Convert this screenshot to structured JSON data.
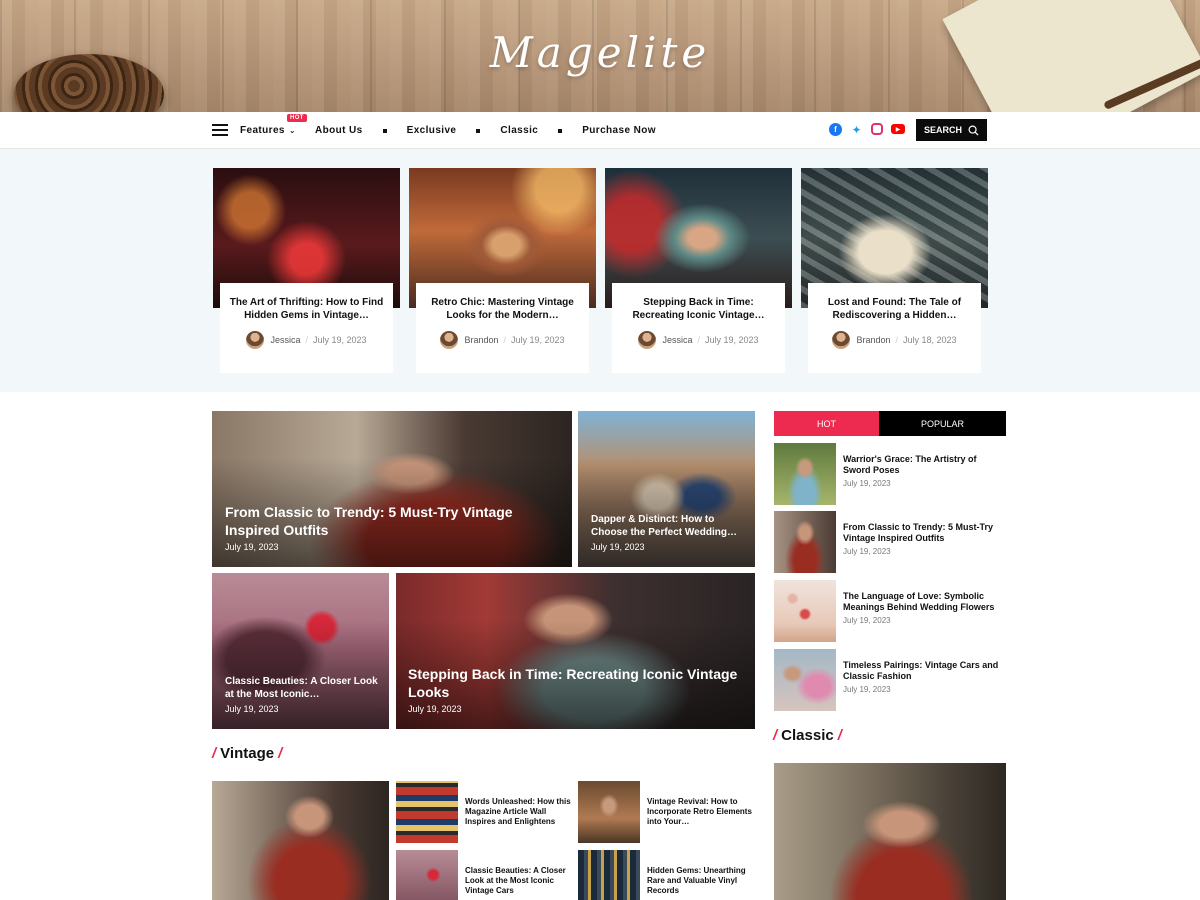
{
  "header": {
    "logo": "Magelite"
  },
  "nav": {
    "items": [
      {
        "label": "Features",
        "badge": "HOT"
      },
      {
        "label": "About Us"
      },
      {
        "label": "Exclusive"
      },
      {
        "label": "Classic"
      },
      {
        "label": "Purchase Now"
      }
    ],
    "search_label": "SEARCH",
    "colors": {
      "facebook": "#1877f2",
      "twitter": "#1da1f2",
      "instagram": "#e1306c",
      "youtube": "#ff0000"
    }
  },
  "featured": [
    {
      "title": "The Art of Thrifting: How to Find Hidden Gems in Vintage…",
      "author": "Jessica",
      "date": "July 19, 2023"
    },
    {
      "title": "Retro Chic: Mastering Vintage Looks for the Modern…",
      "author": "Brandon",
      "date": "July 19, 2023"
    },
    {
      "title": "Stepping Back in Time: Recreating Iconic Vintage…",
      "author": "Jessica",
      "date": "July 19, 2023"
    },
    {
      "title": "Lost and Found: The Tale of Rediscovering a Hidden…",
      "author": "Brandon",
      "date": "July 18, 2023"
    }
  ],
  "mosaic": [
    {
      "title": "From Classic to Trendy: 5 Must-Try Vintage Inspired Outfits",
      "date": "July 19, 2023"
    },
    {
      "title": "Dapper & Distinct: How to Choose the Perfect Wedding…",
      "date": "July 19, 2023"
    },
    {
      "title": "Classic Beauties: A Closer Look at the Most Iconic…",
      "date": "July 19, 2023"
    },
    {
      "title": "Stepping Back in Time: Recreating Iconic Vintage Looks",
      "date": "July 19, 2023"
    }
  ],
  "sidebar": {
    "tabs": {
      "hot": "HOT",
      "popular": "POPULAR"
    },
    "items": [
      {
        "title": "Warrior's Grace: The Artistry of Sword Poses",
        "date": "July 19, 2023"
      },
      {
        "title": "From Classic to Trendy: 5 Must-Try Vintage Inspired Outfits",
        "date": "July 19, 2023"
      },
      {
        "title": "The Language of Love: Symbolic Meanings Behind Wedding Flowers",
        "date": "July 19, 2023"
      },
      {
        "title": "Timeless Pairings: Vintage Cars and Classic Fashion",
        "date": "July 19, 2023"
      }
    ],
    "classic_heading": "Classic"
  },
  "vintage": {
    "heading": "Vintage",
    "items": [
      {
        "title": "Words Unleashed: How this Magazine Article Wall Inspires and Enlightens"
      },
      {
        "title": "Vintage Revival: How to Incorporate Retro Elements into Your…"
      },
      {
        "title": "Classic Beauties: A Closer Look at the Most Iconic Vintage Cars"
      },
      {
        "title": "Hidden Gems: Unearthing Rare and Valuable Vinyl Records"
      }
    ]
  },
  "accent_color": "#ed2a4f"
}
